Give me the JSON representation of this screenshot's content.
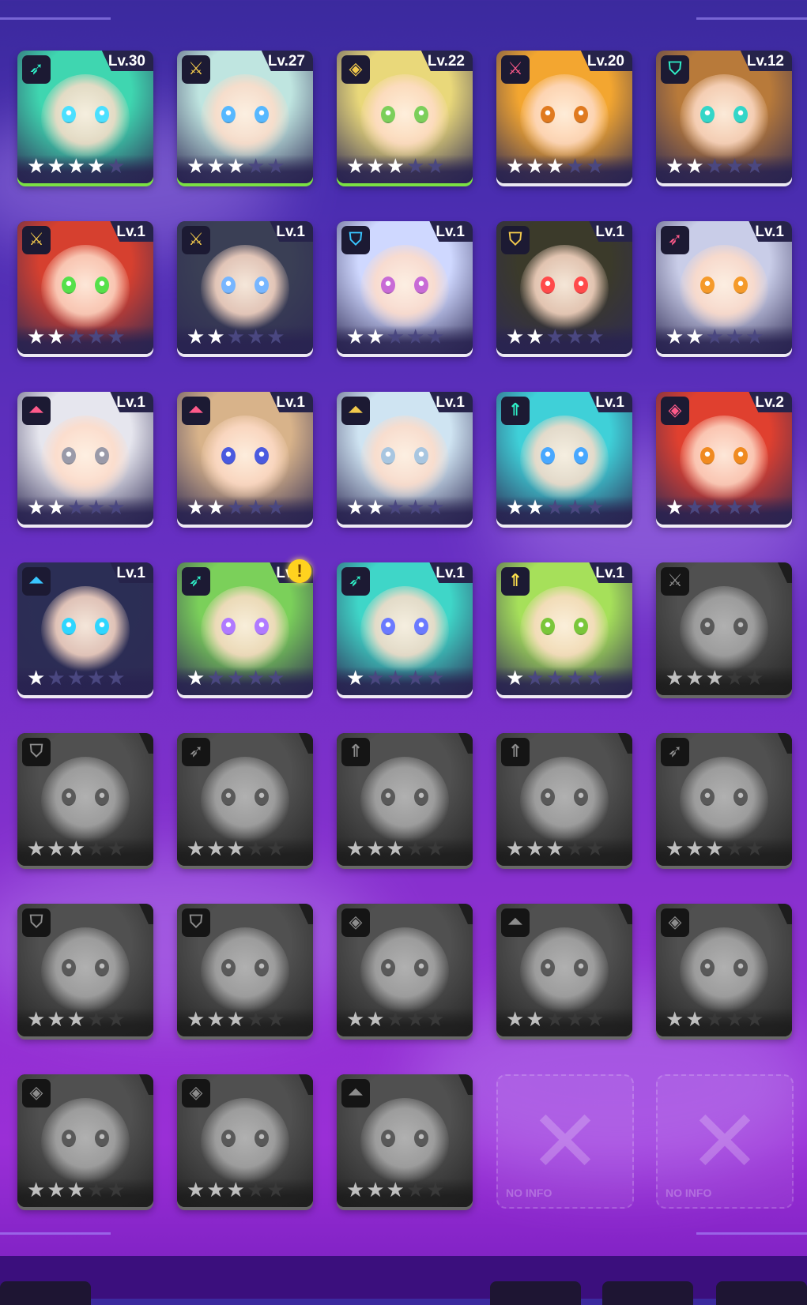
{
  "empty_label": "NO INFO",
  "alert_glyph": "!",
  "role_icons": {
    "archer": "➶",
    "sword": "⚔",
    "mage": "◈",
    "tank": "⛉",
    "support": "⇑",
    "assassin": "⏶"
  },
  "colors": {
    "level_bar_green": "#7be043",
    "icon_teal": "#2ff0c8",
    "icon_gold": "#f2c94c",
    "icon_pink": "#ff5a8a",
    "icon_blue": "#39c6ff",
    "icon_yellow": "#ffe14d"
  },
  "heroes": [
    {
      "level": "Lv.30",
      "stars": 4,
      "role": "archer",
      "color": "#2ff0c8",
      "hue": "#3fd6b0",
      "eye": "#4be0ff",
      "highlight": true
    },
    {
      "level": "Lv.27",
      "stars": 3,
      "role": "sword",
      "color": "#f2c94c",
      "hue": "#bfe5e0",
      "eye": "#56b8ff",
      "highlight": true
    },
    {
      "level": "Lv.22",
      "stars": 3,
      "role": "mage",
      "color": "#f2c94c",
      "hue": "#e9d87a",
      "eye": "#7ccf5a",
      "highlight": true
    },
    {
      "level": "Lv.20",
      "stars": 3,
      "role": "sword",
      "color": "#ff5a8a",
      "hue": "#f3a630",
      "eye": "#e07a1f",
      "highlight": false
    },
    {
      "level": "Lv.12",
      "stars": 2,
      "role": "tank",
      "color": "#2ff0c8",
      "hue": "#b87a3a",
      "eye": "#33d6c8",
      "highlight": false
    },
    {
      "level": "Lv.1",
      "stars": 2,
      "role": "sword",
      "color": "#f2c94c",
      "hue": "#d6402f",
      "eye": "#56e04a",
      "highlight": false
    },
    {
      "level": "Lv.1",
      "stars": 2,
      "role": "sword",
      "color": "#f2c94c",
      "hue": "#3a3f55",
      "eye": "#77b6ff",
      "highlight": false
    },
    {
      "level": "Lv.1",
      "stars": 2,
      "role": "tank",
      "color": "#39c6ff",
      "hue": "#cfd8ff",
      "eye": "#c86bd6",
      "highlight": false
    },
    {
      "level": "Lv.1",
      "stars": 2,
      "role": "tank",
      "color": "#f2c94c",
      "hue": "#3b3a2a",
      "eye": "#ff4a4a",
      "highlight": false
    },
    {
      "level": "Lv.1",
      "stars": 2,
      "role": "archer",
      "color": "#ff5a8a",
      "hue": "#c9cde8",
      "eye": "#f59a2a",
      "highlight": false
    },
    {
      "level": "Lv.1",
      "stars": 2,
      "role": "assassin",
      "color": "#ff5a8a",
      "hue": "#e6e6ee",
      "eye": "#9a9aa8",
      "highlight": false
    },
    {
      "level": "Lv.1",
      "stars": 2,
      "role": "assassin",
      "color": "#ff5a8a",
      "hue": "#d8b38a",
      "eye": "#4a5adf",
      "highlight": false
    },
    {
      "level": "Lv.1",
      "stars": 2,
      "role": "assassin",
      "color": "#f2c94c",
      "hue": "#cfe4f2",
      "eye": "#a8c6e0",
      "highlight": false
    },
    {
      "level": "Lv.1",
      "stars": 2,
      "role": "support",
      "color": "#2ff0c8",
      "hue": "#3fd0d8",
      "eye": "#48a8ff",
      "highlight": false
    },
    {
      "level": "Lv.2",
      "stars": 1,
      "role": "mage",
      "color": "#ff5a8a",
      "hue": "#e0402f",
      "eye": "#f08a20",
      "highlight": false
    },
    {
      "level": "Lv.1",
      "stars": 1,
      "role": "assassin",
      "color": "#39c6ff",
      "hue": "#2b2e55",
      "eye": "#2fd6ff",
      "highlight": false
    },
    {
      "level": "Lv.1",
      "stars": 1,
      "role": "archer",
      "color": "#2ff0c8",
      "hue": "#7bd05a",
      "eye": "#b07aff",
      "highlight": false,
      "alert": true
    },
    {
      "level": "Lv.1",
      "stars": 1,
      "role": "archer",
      "color": "#2ff0c8",
      "hue": "#3fd6c8",
      "eye": "#6a7aff",
      "highlight": false
    },
    {
      "level": "Lv.1",
      "stars": 1,
      "role": "support",
      "color": "#ffe14d",
      "hue": "#a6e05a",
      "eye": "#7ac63a",
      "highlight": false
    },
    {
      "level": "",
      "stars": 3,
      "role": "sword",
      "locked": true
    },
    {
      "level": "",
      "stars": 3,
      "role": "tank",
      "locked": true
    },
    {
      "level": "",
      "stars": 3,
      "role": "archer",
      "locked": true
    },
    {
      "level": "",
      "stars": 3,
      "role": "support",
      "locked": true
    },
    {
      "level": "",
      "stars": 3,
      "role": "support",
      "locked": true
    },
    {
      "level": "",
      "stars": 3,
      "role": "archer",
      "locked": true
    },
    {
      "level": "",
      "stars": 3,
      "role": "tank",
      "locked": true
    },
    {
      "level": "",
      "stars": 3,
      "role": "tank",
      "locked": true
    },
    {
      "level": "",
      "stars": 2,
      "role": "mage",
      "locked": true
    },
    {
      "level": "",
      "stars": 2,
      "role": "assassin",
      "locked": true
    },
    {
      "level": "",
      "stars": 2,
      "role": "mage",
      "locked": true
    },
    {
      "level": "",
      "stars": 3,
      "role": "mage",
      "locked": true
    },
    {
      "level": "",
      "stars": 3,
      "role": "mage",
      "locked": true
    },
    {
      "level": "",
      "stars": 3,
      "role": "assassin",
      "locked": true
    },
    {
      "empty": true
    },
    {
      "empty": true
    }
  ]
}
